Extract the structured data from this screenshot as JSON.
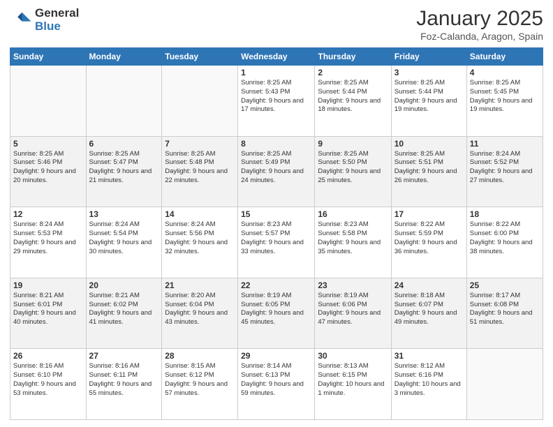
{
  "header": {
    "logo_line1": "General",
    "logo_line2": "Blue",
    "month_title": "January 2025",
    "location": "Foz-Calanda, Aragon, Spain"
  },
  "weekdays": [
    "Sunday",
    "Monday",
    "Tuesday",
    "Wednesday",
    "Thursday",
    "Friday",
    "Saturday"
  ],
  "weeks": [
    [
      {
        "day": "",
        "info": ""
      },
      {
        "day": "",
        "info": ""
      },
      {
        "day": "",
        "info": ""
      },
      {
        "day": "1",
        "info": "Sunrise: 8:25 AM\nSunset: 5:43 PM\nDaylight: 9 hours and 17 minutes."
      },
      {
        "day": "2",
        "info": "Sunrise: 8:25 AM\nSunset: 5:44 PM\nDaylight: 9 hours and 18 minutes."
      },
      {
        "day": "3",
        "info": "Sunrise: 8:25 AM\nSunset: 5:44 PM\nDaylight: 9 hours and 19 minutes."
      },
      {
        "day": "4",
        "info": "Sunrise: 8:25 AM\nSunset: 5:45 PM\nDaylight: 9 hours and 19 minutes."
      }
    ],
    [
      {
        "day": "5",
        "info": "Sunrise: 8:25 AM\nSunset: 5:46 PM\nDaylight: 9 hours and 20 minutes."
      },
      {
        "day": "6",
        "info": "Sunrise: 8:25 AM\nSunset: 5:47 PM\nDaylight: 9 hours and 21 minutes."
      },
      {
        "day": "7",
        "info": "Sunrise: 8:25 AM\nSunset: 5:48 PM\nDaylight: 9 hours and 22 minutes."
      },
      {
        "day": "8",
        "info": "Sunrise: 8:25 AM\nSunset: 5:49 PM\nDaylight: 9 hours and 24 minutes."
      },
      {
        "day": "9",
        "info": "Sunrise: 8:25 AM\nSunset: 5:50 PM\nDaylight: 9 hours and 25 minutes."
      },
      {
        "day": "10",
        "info": "Sunrise: 8:25 AM\nSunset: 5:51 PM\nDaylight: 9 hours and 26 minutes."
      },
      {
        "day": "11",
        "info": "Sunrise: 8:24 AM\nSunset: 5:52 PM\nDaylight: 9 hours and 27 minutes."
      }
    ],
    [
      {
        "day": "12",
        "info": "Sunrise: 8:24 AM\nSunset: 5:53 PM\nDaylight: 9 hours and 29 minutes."
      },
      {
        "day": "13",
        "info": "Sunrise: 8:24 AM\nSunset: 5:54 PM\nDaylight: 9 hours and 30 minutes."
      },
      {
        "day": "14",
        "info": "Sunrise: 8:24 AM\nSunset: 5:56 PM\nDaylight: 9 hours and 32 minutes."
      },
      {
        "day": "15",
        "info": "Sunrise: 8:23 AM\nSunset: 5:57 PM\nDaylight: 9 hours and 33 minutes."
      },
      {
        "day": "16",
        "info": "Sunrise: 8:23 AM\nSunset: 5:58 PM\nDaylight: 9 hours and 35 minutes."
      },
      {
        "day": "17",
        "info": "Sunrise: 8:22 AM\nSunset: 5:59 PM\nDaylight: 9 hours and 36 minutes."
      },
      {
        "day": "18",
        "info": "Sunrise: 8:22 AM\nSunset: 6:00 PM\nDaylight: 9 hours and 38 minutes."
      }
    ],
    [
      {
        "day": "19",
        "info": "Sunrise: 8:21 AM\nSunset: 6:01 PM\nDaylight: 9 hours and 40 minutes."
      },
      {
        "day": "20",
        "info": "Sunrise: 8:21 AM\nSunset: 6:02 PM\nDaylight: 9 hours and 41 minutes."
      },
      {
        "day": "21",
        "info": "Sunrise: 8:20 AM\nSunset: 6:04 PM\nDaylight: 9 hours and 43 minutes."
      },
      {
        "day": "22",
        "info": "Sunrise: 8:19 AM\nSunset: 6:05 PM\nDaylight: 9 hours and 45 minutes."
      },
      {
        "day": "23",
        "info": "Sunrise: 8:19 AM\nSunset: 6:06 PM\nDaylight: 9 hours and 47 minutes."
      },
      {
        "day": "24",
        "info": "Sunrise: 8:18 AM\nSunset: 6:07 PM\nDaylight: 9 hours and 49 minutes."
      },
      {
        "day": "25",
        "info": "Sunrise: 8:17 AM\nSunset: 6:08 PM\nDaylight: 9 hours and 51 minutes."
      }
    ],
    [
      {
        "day": "26",
        "info": "Sunrise: 8:16 AM\nSunset: 6:10 PM\nDaylight: 9 hours and 53 minutes."
      },
      {
        "day": "27",
        "info": "Sunrise: 8:16 AM\nSunset: 6:11 PM\nDaylight: 9 hours and 55 minutes."
      },
      {
        "day": "28",
        "info": "Sunrise: 8:15 AM\nSunset: 6:12 PM\nDaylight: 9 hours and 57 minutes."
      },
      {
        "day": "29",
        "info": "Sunrise: 8:14 AM\nSunset: 6:13 PM\nDaylight: 9 hours and 59 minutes."
      },
      {
        "day": "30",
        "info": "Sunrise: 8:13 AM\nSunset: 6:15 PM\nDaylight: 10 hours and 1 minute."
      },
      {
        "day": "31",
        "info": "Sunrise: 8:12 AM\nSunset: 6:16 PM\nDaylight: 10 hours and 3 minutes."
      },
      {
        "day": "",
        "info": ""
      }
    ]
  ]
}
